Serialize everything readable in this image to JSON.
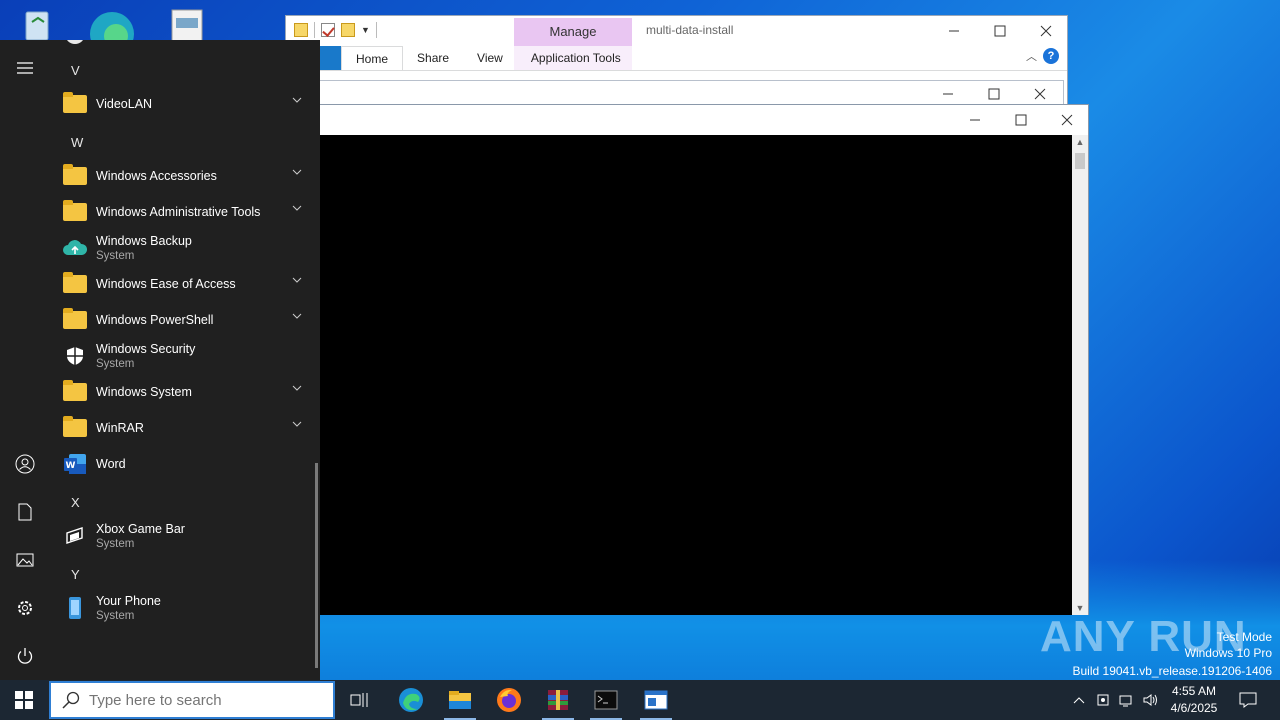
{
  "explorer": {
    "title": "multi-data-install",
    "contextual_tab_group": "Manage",
    "tabs": [
      "Home",
      "Share",
      "View",
      "Application Tools"
    ],
    "help_label": "?"
  },
  "start_menu": {
    "groups": [
      {
        "letter": "V",
        "apps": [
          {
            "name": "VideoLAN",
            "icon": "folder-icon",
            "expandable": true
          }
        ]
      },
      {
        "letter": "W",
        "apps": [
          {
            "name": "Windows Accessories",
            "icon": "folder-icon",
            "expandable": true
          },
          {
            "name": "Windows Administrative Tools",
            "icon": "folder-icon",
            "expandable": true
          },
          {
            "name": "Windows Backup",
            "sub": "System",
            "icon": "cloud-backup-icon"
          },
          {
            "name": "Windows Ease of Access",
            "icon": "folder-icon",
            "expandable": true
          },
          {
            "name": "Windows PowerShell",
            "icon": "folder-icon",
            "expandable": true
          },
          {
            "name": "Windows Security",
            "sub": "System",
            "icon": "shield-icon"
          },
          {
            "name": "Windows System",
            "icon": "folder-icon",
            "expandable": true
          },
          {
            "name": "WinRAR",
            "icon": "folder-icon",
            "expandable": true
          },
          {
            "name": "Word",
            "icon": "word-icon"
          }
        ]
      },
      {
        "letter": "X",
        "apps": [
          {
            "name": "Xbox Game Bar",
            "sub": "System",
            "icon": "xbox-game-bar-icon"
          }
        ]
      },
      {
        "letter": "Y",
        "apps": [
          {
            "name": "Your Phone",
            "sub": "System",
            "icon": "phone-icon"
          }
        ]
      }
    ],
    "rail": [
      "hamburger-menu-icon",
      "user-icon",
      "documents-icon",
      "pictures-icon",
      "settings-icon",
      "power-icon"
    ]
  },
  "taskbar": {
    "search_placeholder": "Type here to search",
    "apps": [
      "task-view-icon",
      "edge-icon",
      "file-explorer-icon",
      "firefox-icon",
      "winrar-icon",
      "cmd-icon",
      "window-app-icon"
    ],
    "time": "4:55 AM",
    "date": "4/6/2025"
  },
  "watermark": {
    "logo": "ANY RUN",
    "line1": "Test Mode",
    "line2": "Windows 10 Pro",
    "line3": "Build 19041.vb_release.191206-1406"
  },
  "colors": {
    "start_bg": "#202020",
    "taskbar_bg": "#1c2733",
    "folder": "#f4c542",
    "accent": "#1979ca"
  }
}
